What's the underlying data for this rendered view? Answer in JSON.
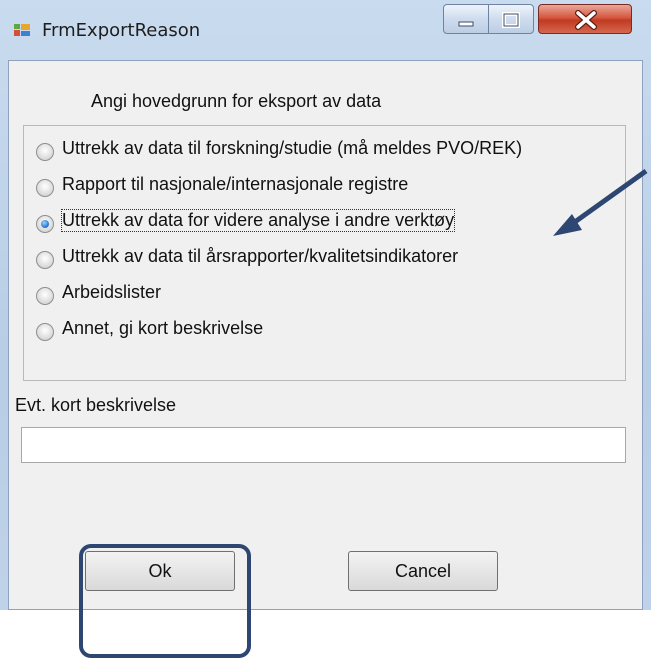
{
  "window": {
    "title": "FrmExportReason",
    "controls": [
      "minimize-icon",
      "maximize-icon",
      "close-icon"
    ],
    "accent": "#2e4672"
  },
  "form": {
    "heading": "Angi hovedgrunn for eksport av data",
    "options": [
      {
        "label": "Uttrekk av data til forskning/studie (må meldes PVO/REK)",
        "checked": false
      },
      {
        "label": "Rapport til nasjonale/internasjonale registre",
        "checked": false
      },
      {
        "label": "Uttrekk av data for videre analyse i andre verktøy",
        "checked": true
      },
      {
        "label": "Uttrekk av data til årsrapporter/kvalitetsindikatorer",
        "checked": false
      },
      {
        "label": "Arbeidslister",
        "checked": false
      },
      {
        "label": "Annet, gi kort beskrivelse",
        "checked": false
      }
    ],
    "description_label": "Evt. kort beskrivelse",
    "description_value": ""
  },
  "buttons": {
    "ok": "Ok",
    "cancel": "Cancel"
  }
}
